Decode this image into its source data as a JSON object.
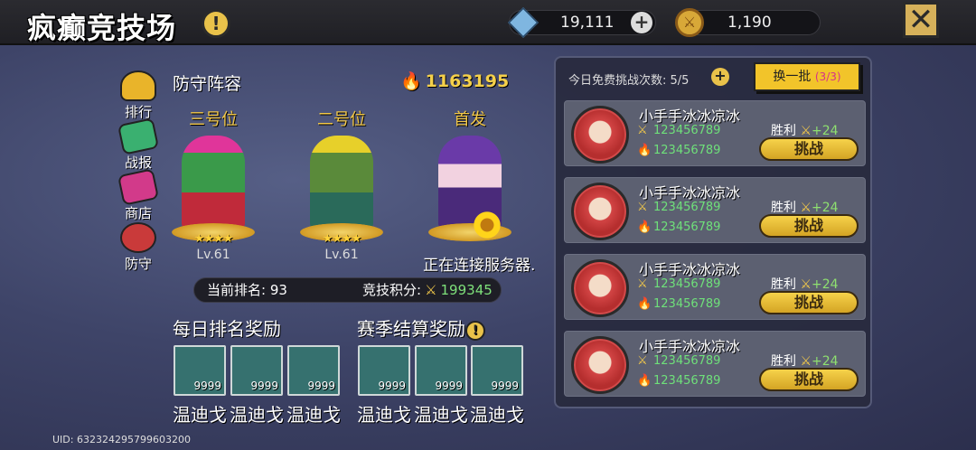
{
  "header": {
    "title": "疯癫竞技场",
    "gems": "19,111",
    "coins": "1,190"
  },
  "side_menu": [
    "排行",
    "战报",
    "商店",
    "防守"
  ],
  "defense": {
    "title": "防守阵容",
    "power": "1163195",
    "heroes": [
      {
        "position": "三号位",
        "stars": "★★★★",
        "level": "Lv.61"
      },
      {
        "position": "二号位",
        "stars": "★★★★",
        "level": "Lv.61"
      },
      {
        "position": "首发",
        "stars": "",
        "level": ""
      }
    ]
  },
  "status": {
    "connecting": "正在连接服务器."
  },
  "rank": {
    "rank_label": "当前排名: 93",
    "score_label": "竞技积分:",
    "score_value": "199345"
  },
  "rewards": {
    "daily_title": "每日排名奖励",
    "season_title": "赛季结算奖励",
    "items": [
      {
        "count": "9999",
        "name": "温迪戈"
      },
      {
        "count": "9999",
        "name": "温迪戈"
      },
      {
        "count": "9999",
        "name": "温迪戈"
      },
      {
        "count": "9999",
        "name": "温迪戈"
      },
      {
        "count": "9999",
        "name": "温迪戈"
      },
      {
        "count": "9999",
        "name": "温迪戈"
      }
    ]
  },
  "uid": "UID: 632324295799603200",
  "panel": {
    "free_label": "今日免费挑战次数: 5/5",
    "refresh_label": "换一批",
    "refresh_count": "(3/3)",
    "opponents": [
      {
        "name": "小手手冰冰凉冰",
        "score": "123456789",
        "power": "123456789",
        "win_label": "胜利",
        "win_points": "+24",
        "button": "挑战"
      },
      {
        "name": "小手手冰冰凉冰",
        "score": "123456789",
        "power": "123456789",
        "win_label": "胜利",
        "win_points": "+24",
        "button": "挑战"
      },
      {
        "name": "小手手冰冰凉冰",
        "score": "123456789",
        "power": "123456789",
        "win_label": "胜利",
        "win_points": "+24",
        "button": "挑战"
      },
      {
        "name": "小手手冰冰凉冰",
        "score": "123456789",
        "power": "123456789",
        "win_label": "胜利",
        "win_points": "+24",
        "button": "挑战"
      }
    ]
  }
}
